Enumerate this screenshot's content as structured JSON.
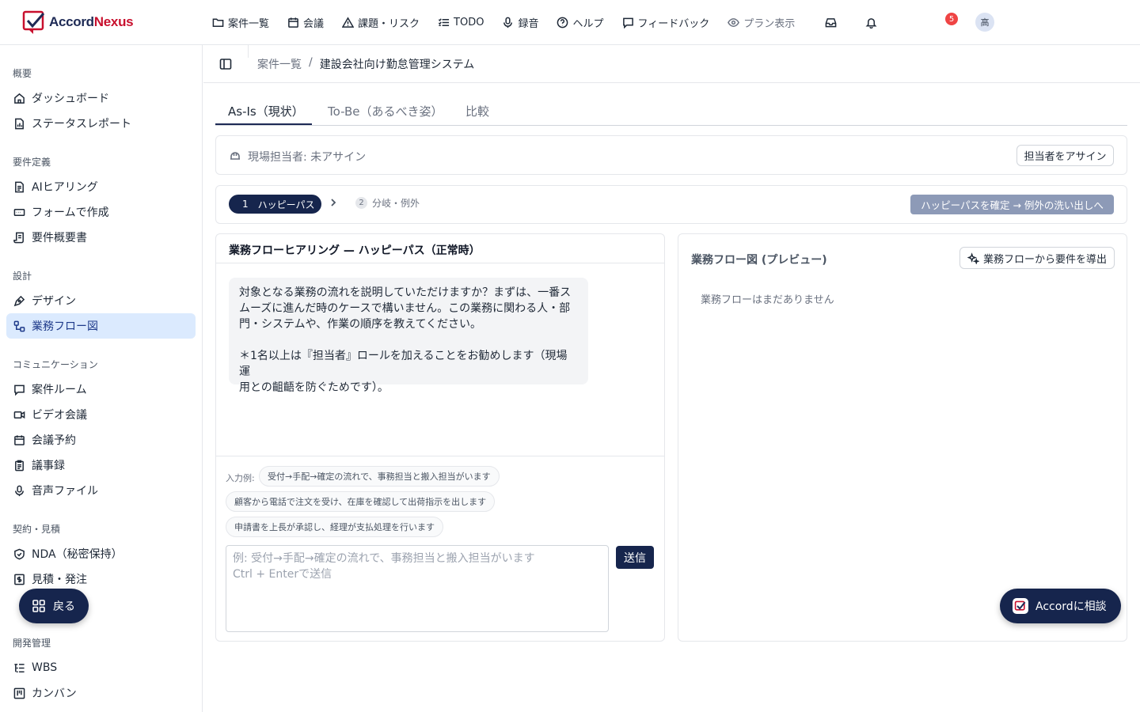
{
  "app": {
    "logo_prefix": "Accord",
    "logo_suffix": "Nexus"
  },
  "topnav": {
    "items": [
      {
        "label": "案件一覧",
        "icon": "folder-icon"
      },
      {
        "label": "会議",
        "icon": "calendar-icon"
      },
      {
        "label": "課題・リスク",
        "icon": "warning-icon"
      },
      {
        "label": "TODO",
        "icon": "checklist-icon"
      },
      {
        "label": "録音",
        "icon": "mic-icon"
      },
      {
        "label": "ヘルプ",
        "icon": "help-icon"
      },
      {
        "label": "フィードバック",
        "icon": "message-icon"
      },
      {
        "label": "プラン表示",
        "icon": "eye-icon"
      }
    ],
    "notification_count": "5",
    "avatar_initial": "高"
  },
  "sidebar": {
    "sections": [
      {
        "label": "概要",
        "items": [
          "ダッシュボード",
          "ステータスレポート"
        ]
      },
      {
        "label": "要件定義",
        "items": [
          "AIヒアリング",
          "フォームで作成",
          "要件概要書"
        ]
      },
      {
        "label": "設計",
        "items": [
          "デザイン",
          "業務フロー図"
        ]
      },
      {
        "label": "コミュニケーション",
        "items": [
          "案件ルーム",
          "ビデオ会議",
          "会議予約",
          "議事録",
          "音声ファイル"
        ]
      },
      {
        "label": "契約・見積",
        "items": [
          "NDA（秘密保持）",
          "見積・発注"
        ]
      },
      {
        "label": "開発管理",
        "items": [
          "WBS",
          "カンバン"
        ]
      }
    ],
    "active_item": "業務フロー図",
    "back_label": "戻る"
  },
  "breadcrumb": {
    "parent": "案件一覧",
    "separator": "/",
    "current": "建設会社向け勤怠管理システム"
  },
  "tabs": [
    {
      "label": "As-Is（現状）",
      "active": true
    },
    {
      "label": "To-Be（あるべき姿）",
      "active": false
    },
    {
      "label": "比較",
      "active": false
    }
  ],
  "owner": {
    "label": "現場担当者:",
    "value": "未アサイン",
    "assign_button": "担当者をアサイン"
  },
  "steps": {
    "step1_num": "1",
    "step1_label": "ハッピーパス",
    "step2_num": "2",
    "step2_label": "分岐・例外",
    "confirm_button": "ハッピーパスを確定 → 例外の洗い出しへ"
  },
  "chat": {
    "title": "業務フローヒアリング — ハッピーパス（正常時）",
    "message_lines": [
      "対象となる業務の流れを説明していただけますか？まずは、一番ス",
      "ムーズに進んだ時のケースで構いません。この業務に関わる人・部",
      "門・システムや、作業の順序を教えてください。",
      "＊1名以上は『担当者』ロールを加えることをお勧めします（現場運",
      "用との齟齬を防ぐためです）。"
    ],
    "examples_label": "入力例:",
    "examples": [
      "受付→手配→確定の流れで、事務担当と搬入担当がいます",
      "顧客から電話で注文を受け、在庫を確認して出荷指示を出します",
      "申請書を上長が承認し、経理が支払処理を行います"
    ],
    "input_placeholder_line1": "例: 受付→手配→確定の流れで、事務担当と搬入担当がいます",
    "input_placeholder_line2": "Ctrl + Enterで送信",
    "send_button": "送信"
  },
  "preview": {
    "title": "業務フロー図 (プレビュー)",
    "derive_button": "業務フローから要件を導出",
    "empty_text": "業務フローはまだありません"
  },
  "consult_button": "Accordに相談",
  "colors": {
    "navy": "#16254d",
    "active_bg": "#dbeafe",
    "badge": "#ef4444"
  }
}
